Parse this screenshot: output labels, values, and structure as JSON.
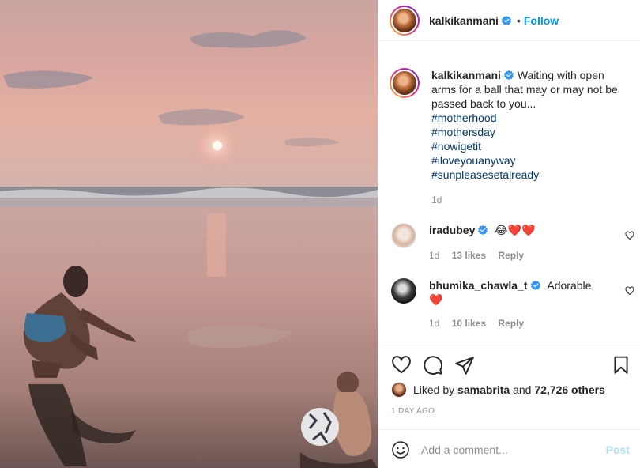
{
  "post": {
    "username": "kalkikanmani",
    "follow_label": "Follow",
    "dot": "•",
    "caption": "Waiting with open arms for a ball that may or may not be passed back to you...",
    "hashtags": [
      "#motherhood",
      "#mothersday",
      "#nowigetit",
      "#iloveyouanyway",
      "#sunpleasesetalready"
    ],
    "caption_time": "1d"
  },
  "comments": [
    {
      "username": "iradubey",
      "text": "😂❤️❤️",
      "time": "1d",
      "likes": "13 likes",
      "reply": "Reply"
    },
    {
      "username": "bhumika_chawla_t",
      "text": "Adorable",
      "emoji": "❤️",
      "time": "1d",
      "likes": "10 likes",
      "reply": "Reply"
    }
  ],
  "likes": {
    "prefix": "Liked by",
    "first_user": "samabrita",
    "connector": "and",
    "others": "72,726 others"
  },
  "date": "1 DAY AGO",
  "comment_box": {
    "placeholder": "Add a comment...",
    "post_label": "Post"
  },
  "colors": {
    "accent": "#0095f6",
    "hashtag": "#00376b",
    "muted": "#8e8e8e",
    "post_disabled": "#b2dffc",
    "verified": "#3897f0"
  },
  "icons": [
    "heart-icon",
    "comment-icon",
    "share-icon",
    "bookmark-icon",
    "emoji-icon",
    "verified-badge-icon"
  ]
}
